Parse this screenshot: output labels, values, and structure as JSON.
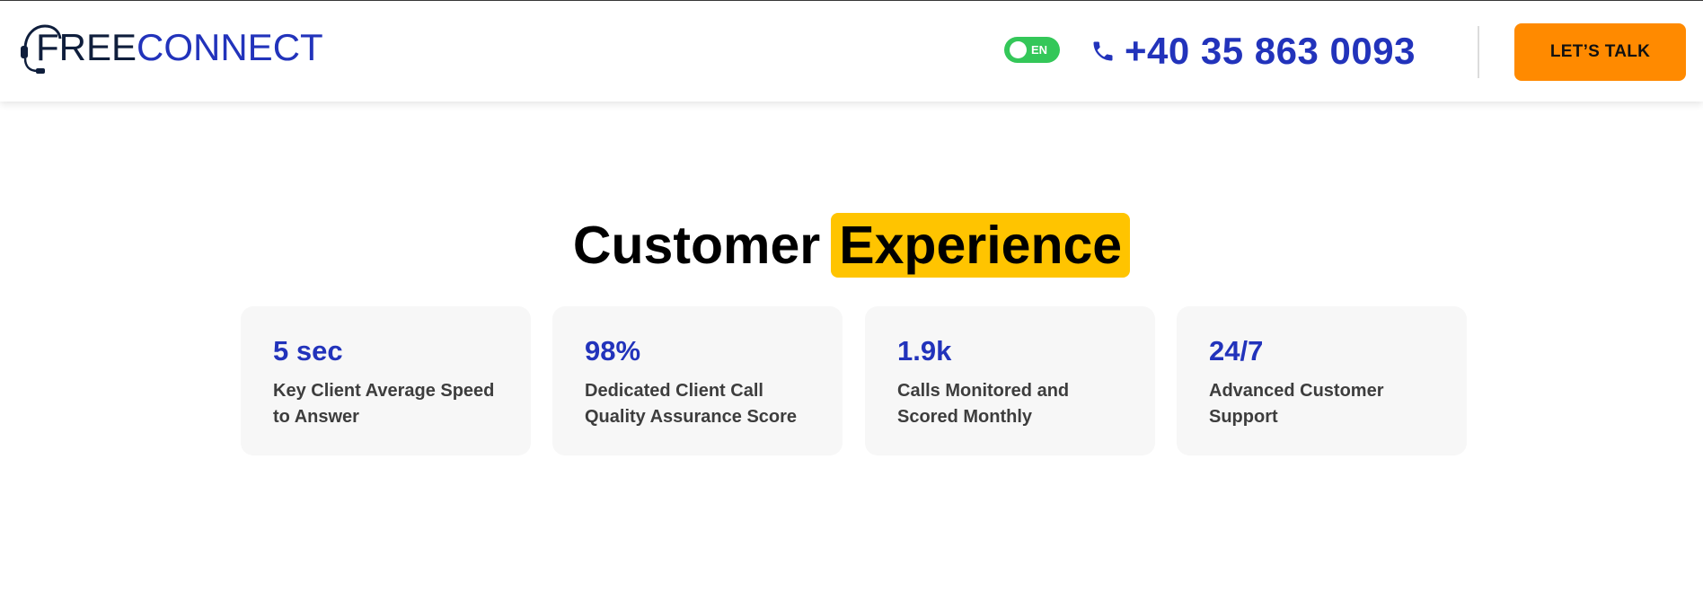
{
  "header": {
    "logo": {
      "part1": "FREE",
      "part2": "CONNECT"
    },
    "language": {
      "label": "EN"
    },
    "phone": {
      "number": "+40 35 863 0093"
    },
    "cta_label": "LET’S TALK"
  },
  "main": {
    "title_plain": "Customer",
    "title_highlight": "Experience",
    "stats": [
      {
        "value": "5 sec",
        "description": "Key Client Average Speed to Answer"
      },
      {
        "value": "98%",
        "description": "Dedicated Client Call Quality Assurance Score"
      },
      {
        "value": "1.9k",
        "description": "Calls Monitored and Scored Monthly"
      },
      {
        "value": "24/7",
        "description": "Advanced Customer Support"
      }
    ]
  },
  "colors": {
    "brand_blue": "#2233bb",
    "cta_orange": "#ff8a00",
    "highlight_yellow": "#ffc400",
    "toggle_green": "#34c759"
  },
  "icons": {
    "logo": "headset-icon",
    "phone": "phone-icon"
  }
}
